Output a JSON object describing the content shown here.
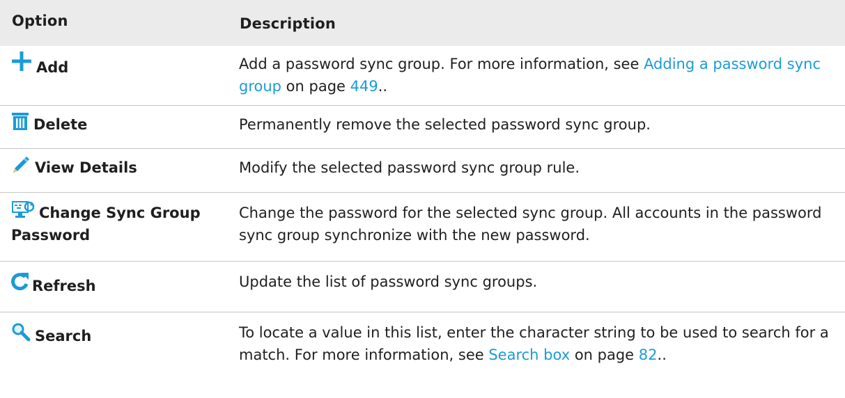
{
  "header": {
    "option": "Option",
    "description": "Description"
  },
  "rows": [
    {
      "icon": "plus-icon",
      "label": "Add",
      "desc_before": "Add a password sync group. For more information, see ",
      "link": "Adding a password sync group",
      "desc_mid": " on page ",
      "page": "449",
      "desc_after": ".."
    },
    {
      "icon": "trash-icon",
      "label": "Delete",
      "desc": "Permanently remove the selected password sync group."
    },
    {
      "icon": "pencil-icon",
      "label": "View Details",
      "desc": "Modify the selected password sync group rule."
    },
    {
      "icon": "monitor-sync-icon",
      "label": "Change Sync Group Password",
      "desc": "Change the password for the selected sync group. All accounts in the password sync group synchronize with the new password."
    },
    {
      "icon": "refresh-icon",
      "label": "Refresh",
      "desc": "Update the list of password sync groups."
    },
    {
      "icon": "search-icon",
      "label": "Search",
      "desc_before": "To locate a value in this list, enter the character string to be used to search for a match. For more information, see ",
      "link": "Search box",
      "desc_mid": " on page ",
      "page": "82",
      "desc_after": ".."
    }
  ],
  "colors": {
    "header_bg": "#ebebeb",
    "icon_blue": "#1a9bd7",
    "link": "#1a9bd7",
    "row_border": "#c4c4c4"
  }
}
